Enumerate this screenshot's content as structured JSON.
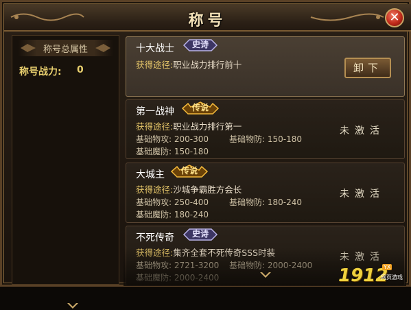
{
  "window": {
    "title": "称号",
    "close_glyph": "✕"
  },
  "left_panel": {
    "header": "称号总属性",
    "power_label": "称号战力:",
    "power_value": "0"
  },
  "titles": [
    {
      "name": "十大战士",
      "badge": "史诗",
      "badge_color": "#b9b3e8",
      "acquire_label": "获得途径:",
      "acquire_value": "职业战力排行前十",
      "selected": true,
      "button": "卸下"
    },
    {
      "name": "第一战神",
      "badge": "传说",
      "badge_color": "#f2b83a",
      "acquire_label": "获得途径:",
      "acquire_value": "职业战力排行第一",
      "stats": [
        {
          "label": "基础物攻:",
          "value": "200-300"
        },
        {
          "label": "基础物防:",
          "value": "150-180"
        },
        {
          "label": "基础魔防:",
          "value": "150-180"
        }
      ],
      "status": "未激活"
    },
    {
      "name": "大城主",
      "badge": "传说",
      "badge_color": "#f2b83a",
      "acquire_label": "获得途径:",
      "acquire_value": "沙城争霸胜方会长",
      "stats": [
        {
          "label": "基础物攻:",
          "value": "250-400"
        },
        {
          "label": "基础物防:",
          "value": "180-240"
        },
        {
          "label": "基础魔防:",
          "value": "180-240"
        }
      ],
      "status": "未激活"
    },
    {
      "name": "不死传奇",
      "badge": "史诗",
      "badge_color": "#b9b3e8",
      "acquire_label": "获得途径:",
      "acquire_value": "集齐全套不死传奇SSS时装",
      "stats": [
        {
          "label": "基础物攻:",
          "value": "2721-3200"
        },
        {
          "label": "基础物防:",
          "value": "2000-2400"
        },
        {
          "label": "基础魔防:",
          "value": "2000-2400"
        }
      ],
      "status": "未激活"
    }
  ],
  "watermark": {
    "number": "1912",
    "tag": "YX",
    "sub": "网页游戏"
  }
}
